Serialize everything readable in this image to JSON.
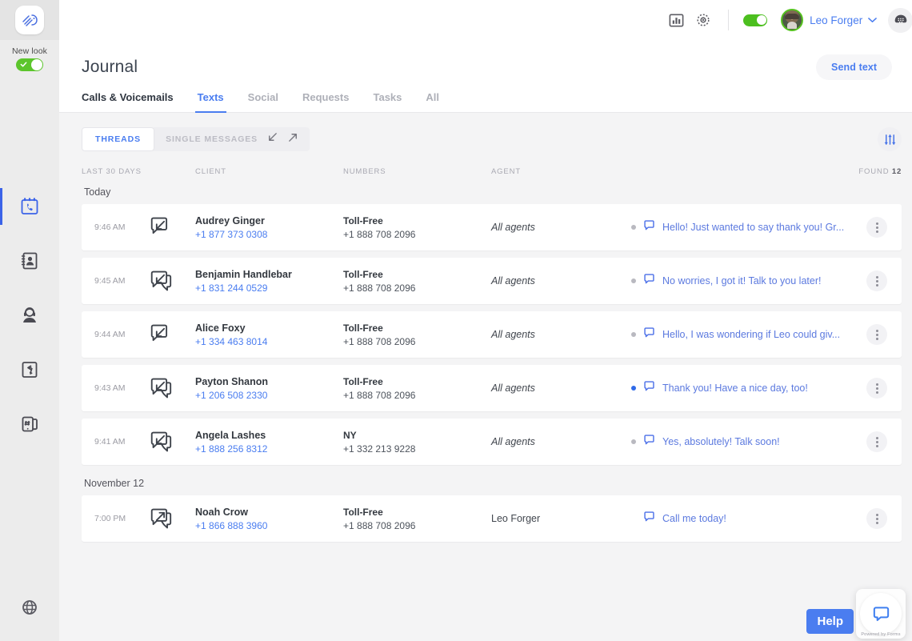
{
  "rail": {
    "logo_icon": "hand-wave-logo-icon",
    "new_look": {
      "label": "New look",
      "enabled": true
    },
    "items": [
      {
        "name": "journal",
        "icon": "calendar-phone-icon",
        "active": true
      },
      {
        "name": "contacts",
        "icon": "contacts-book-icon",
        "active": false
      },
      {
        "name": "agents",
        "icon": "headset-agent-icon",
        "active": false
      },
      {
        "name": "call-flows",
        "icon": "call-routing-icon",
        "active": false
      },
      {
        "name": "numbers",
        "icon": "phone-hash-icon",
        "active": false
      }
    ],
    "bottom_icon": "globe-icon"
  },
  "topbar": {
    "analytics_icon": "bar-chart-icon",
    "settings_icon": "gear-icon",
    "status_toggle": {
      "icon": "availability-toggle",
      "enabled": true
    },
    "user": {
      "name": "Leo Forger",
      "avatar": "user-avatar",
      "caret": "chevron-down-icon"
    },
    "dialpad_icon": "dialpad-icon"
  },
  "page": {
    "title": "Journal",
    "send_text_label": "Send text"
  },
  "tabs": [
    {
      "label": "Calls & Voicemails",
      "state": "strong"
    },
    {
      "label": "Texts",
      "state": "active"
    },
    {
      "label": "Social",
      "state": "muted"
    },
    {
      "label": "Requests",
      "state": "muted"
    },
    {
      "label": "Tasks",
      "state": "muted"
    },
    {
      "label": "All",
      "state": "muted"
    }
  ],
  "toolbar": {
    "threads_label": "THREADS",
    "single_messages_label": "SINGLE MESSAGES",
    "incoming_icon": "arrow-down-left-icon",
    "outgoing_icon": "arrow-up-right-icon",
    "filter_icon": "filter-sliders-icon"
  },
  "columns": {
    "period": "LAST 30 DAYS",
    "client": "CLIENT",
    "numbers": "NUMBERS",
    "agent": "AGENT",
    "found_label": "Found",
    "found_count": "12"
  },
  "groups": [
    {
      "day": "Today",
      "rows": [
        {
          "time": "9:46 AM",
          "direction": "incoming",
          "thread": false,
          "client_name": "Audrey Ginger",
          "client_phone": "+1 877 373 0308",
          "number_label": "Toll-Free",
          "number_phone": "+1 888 708 2096",
          "agent": "All agents",
          "agent_italic": true,
          "status": "read",
          "message": "Hello! Just wanted to say thank you! Gr..."
        },
        {
          "time": "9:45 AM",
          "direction": "incoming",
          "thread": true,
          "client_name": "Benjamin Handlebar",
          "client_phone": "+1 831 244 0529",
          "number_label": "Toll-Free",
          "number_phone": "+1 888 708 2096",
          "agent": "All agents",
          "agent_italic": true,
          "status": "read",
          "message": "No worries, I got it! Talk to you later!"
        },
        {
          "time": "9:44 AM",
          "direction": "incoming",
          "thread": false,
          "client_name": "Alice Foxy",
          "client_phone": "+1 334 463 8014",
          "number_label": "Toll-Free",
          "number_phone": "+1 888 708 2096",
          "agent": "All agents",
          "agent_italic": true,
          "status": "read",
          "message": "Hello, I was wondering if Leo could giv..."
        },
        {
          "time": "9:43 AM",
          "direction": "incoming",
          "thread": true,
          "client_name": "Payton Shanon",
          "client_phone": "+1 206 508 2330",
          "number_label": "Toll-Free",
          "number_phone": "+1 888 708 2096",
          "agent": "All agents",
          "agent_italic": true,
          "status": "unread",
          "message": "Thank you! Have a nice day, too!"
        },
        {
          "time": "9:41 AM",
          "direction": "incoming",
          "thread": true,
          "client_name": "Angela Lashes",
          "client_phone": "+1 888 256 8312",
          "number_label": "NY",
          "number_phone": "+1 332 213 9228",
          "agent": "All agents",
          "agent_italic": true,
          "status": "read",
          "message": "Yes, absolutely! Talk soon!"
        }
      ]
    },
    {
      "day": "November 12",
      "rows": [
        {
          "time": "7:00 PM",
          "direction": "outgoing",
          "thread": true,
          "client_name": "Noah Crow",
          "client_phone": "+1 866 888 3960",
          "number_label": "Toll-Free",
          "number_phone": "+1 888 708 2096",
          "agent": "Leo Forger",
          "agent_italic": false,
          "status": "none",
          "message": "Call me today!"
        }
      ]
    }
  ],
  "footer": {
    "help_label": "Help",
    "chat_icon": "chat-bubble-icon",
    "widget_caption": "Powered by Forms"
  },
  "colors": {
    "accent_blue": "#4a7df0",
    "green": "#4cbf1f",
    "page_bg": "#f4f4f5",
    "rail_bg": "#ececec"
  }
}
